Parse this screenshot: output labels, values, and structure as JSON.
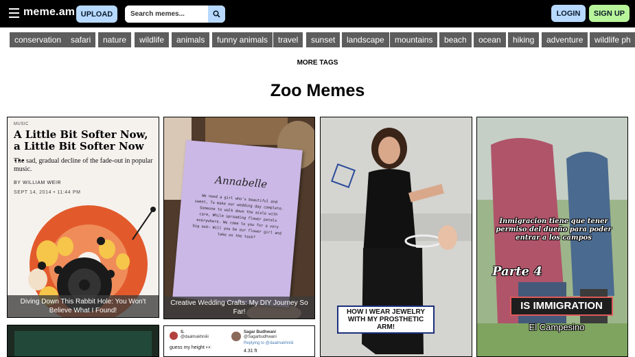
{
  "header": {
    "logo": "meme.am",
    "upload_label": "UPLOAD",
    "search_placeholder": "Search memes...",
    "login_label": "LOGIN",
    "signup_label": "SIGN UP"
  },
  "tags": [
    "conservation",
    "safari",
    "nature",
    "wildlife",
    "animals",
    "funny animals",
    "travel",
    "sunset",
    "landscape",
    "mountains",
    "beach",
    "ocean",
    "hiking",
    "adventure",
    "wildlife ph"
  ],
  "more_tags_label": "MORE TAGS",
  "page_title": "Zoo Memes",
  "cards": {
    "article": {
      "category": "MUSIC",
      "title": "A Little Bit Softer Now, a Little Bit Softer Now ...",
      "subtitle": "The sad, gradual decline of the fade-out in popular music.",
      "byline": "BY WILLIAM WEIR",
      "date": "SEPT 14, 2014 • 11:44 PM",
      "caption": "Diving Down This Rabbit Hole: You Won't Believe What I Found!"
    },
    "wedding": {
      "name": "Annabelle",
      "poem": "We need a girl who's beautiful and sweet, To make our wedding day complete. Someone to walk down the aisle with care, While spreading flower petals everywhere. We come to you for a very big ask– Will you be our flower girl and take on the task?",
      "caption": "Creative Wedding Crafts: My DIY Journey So Far!"
    },
    "jewelry": {
      "banner": "HOW I WEAR JEWELRY WITH MY PROSTHETIC ARM!"
    },
    "immigration": {
      "line1": "Inmigracion tiene que tener permiso del dueño para poder entrar a los campos",
      "line2": "Parte 4",
      "line3": "IS IMMIGRATION",
      "line4": "El Campesino"
    },
    "tweet": {
      "user1": "S.",
      "handle1": "@daalmakhniiii",
      "text1": "guess my height 👀",
      "user2": "Sagar Budhwani",
      "handle2": "@Sagarbudhwani",
      "reply": "Replying to @daalmakhniiii",
      "text2": "4.31 ft"
    }
  },
  "colors": {
    "header_bg": "#000000",
    "upload_btn": "#b7d9ff",
    "signup_btn": "#b8f49a",
    "tag_bg": "#5d5d5d"
  }
}
